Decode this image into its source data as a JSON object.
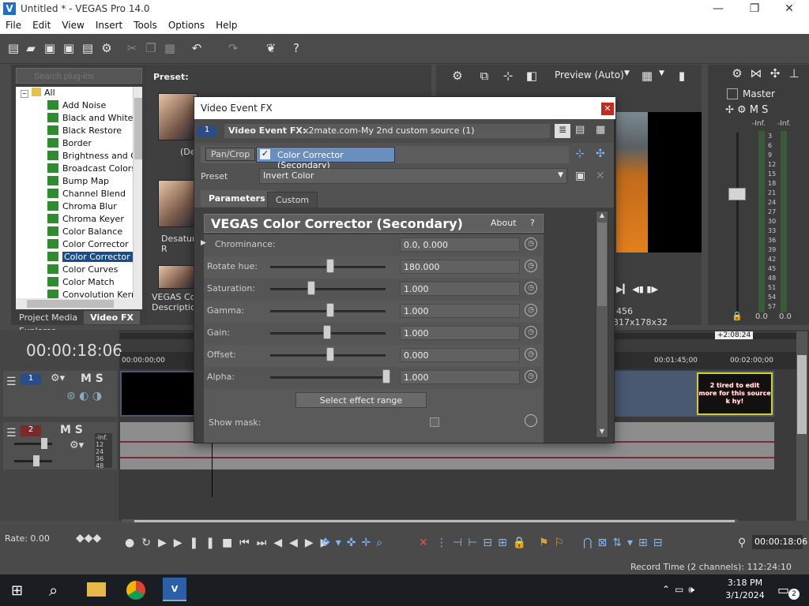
{
  "window": {
    "title": "Untitled * - VEGAS Pro 14.0",
    "minimize": "—",
    "maximize": "❐",
    "close": "✕"
  },
  "menu": [
    "File",
    "Edit",
    "View",
    "Insert",
    "Tools",
    "Options",
    "Help"
  ],
  "plugins": {
    "search_placeholder": "Search plug-ins",
    "items": [
      "All",
      "Add Noise",
      "Black and White",
      "Black Restore",
      "Border",
      "Brightness and Co",
      "Broadcast Colors",
      "Bump Map",
      "Channel Blend",
      "Chroma Blur",
      "Chroma Keyer",
      "Color Balance",
      "Color Corrector",
      "Color Corrector (S",
      "Color Curves",
      "Color Match",
      "Convolution Kerne"
    ],
    "selected_index": 13,
    "tabs": [
      "Project Media",
      "Video FX",
      "Explorer"
    ]
  },
  "presets": {
    "header": "Preset:",
    "labels": [
      "(De",
      "Desatura\nR",
      "VEGAS Colo\nDescription"
    ]
  },
  "preview": {
    "quality": "Preview (Auto)",
    "frame": "456",
    "resolution": "317x178x32"
  },
  "master": {
    "title": "Master",
    "db_left": "-Inf.",
    "db_right": "-Inf.",
    "scale": [
      "3",
      "6",
      "9",
      "12",
      "15",
      "18",
      "21",
      "24",
      "27",
      "30",
      "33",
      "36",
      "39",
      "42",
      "45",
      "48",
      "51",
      "54",
      "57"
    ],
    "bottom_left": "0.0",
    "bottom_right": "0.0"
  },
  "timeline": {
    "timecode": "00:00:18:06",
    "ruler": [
      "00:00:00;00",
      "00:01:45;00",
      "00:02:00;00"
    ],
    "region_marker": "+2:08:24",
    "video_track_num": "1",
    "audio_track_num": "2",
    "clip_text": "2 tired to edit\nmore for this source\nk hy!",
    "audio_levels": [
      "-Inf.",
      "12",
      "24",
      "36",
      "48"
    ]
  },
  "transport": {
    "rate": "Rate: 0.00",
    "time": "00:00:18:06",
    "record_time": "Record Time (2 channels): 112:24:10"
  },
  "taskbar": {
    "time": "3:18 PM",
    "date": "3/1/2024",
    "notif_count": "2"
  },
  "dialog": {
    "title": "Video Event FX",
    "close": "✕",
    "track_badge": "1",
    "fx_label": "Video Event FX:",
    "fx_source": "x2mate.com-My 2nd custom source (1)",
    "chain": [
      "Pan/Crop",
      "Color Corrector (Secondary)"
    ],
    "preset_label": "Preset",
    "preset_value": "Invert Color",
    "tabs": [
      "Parameters",
      "Custom"
    ],
    "plugin_title": "VEGAS Color Corrector (Secondary)",
    "about": "About",
    "help": "?",
    "params": [
      {
        "label": "Chrominance:",
        "value": "0.0, 0.000",
        "level": null
      },
      {
        "label": "Rotate hue:",
        "value": "180.000",
        "level": 0.5
      },
      {
        "label": "Saturation:",
        "value": "1.000",
        "level": 0.33
      },
      {
        "label": "Gamma:",
        "value": "1.000",
        "level": 0.5
      },
      {
        "label": "Gain:",
        "value": "1.000",
        "level": 0.47
      },
      {
        "label": "Offset:",
        "value": "0.000",
        "level": 0.5
      },
      {
        "label": "Alpha:",
        "value": "1.000",
        "level": 1.0
      }
    ],
    "select_range": "Select effect range",
    "show_mask": "Show mask:"
  },
  "colors": {
    "accent": "#1a4c8a",
    "close_red": "#c42b1c",
    "fx_green": "#2e8b2e",
    "clip_red": "#c3262d"
  }
}
